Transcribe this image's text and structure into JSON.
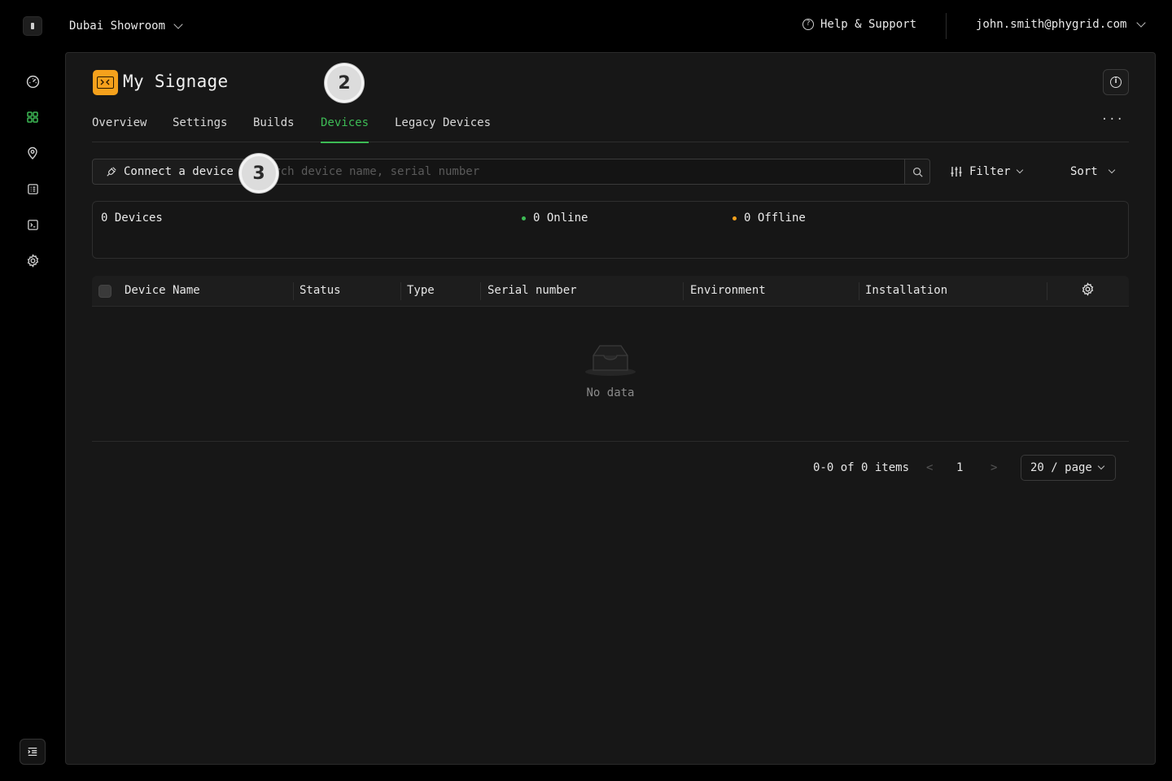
{
  "header": {
    "workspace": "Dubai Showroom",
    "help_label": "Help & Support",
    "user_email": "john.smith@phygrid.com"
  },
  "rail": {
    "items": [
      {
        "icon": "dashboard-gauge-icon",
        "active": false
      },
      {
        "icon": "grid-apps-icon",
        "active": true
      },
      {
        "icon": "location-pin-icon",
        "active": false
      },
      {
        "icon": "list-document-icon",
        "active": false
      },
      {
        "icon": "terminal-icon",
        "active": false
      },
      {
        "icon": "gear-icon",
        "active": false
      }
    ],
    "collapse_icon": "sidebar-collapse-icon"
  },
  "project": {
    "title": "My Signage",
    "icon_color": "#f5a11c"
  },
  "tabs": [
    {
      "label": "Overview",
      "active": false
    },
    {
      "label": "Settings",
      "active": false
    },
    {
      "label": "Builds",
      "active": false
    },
    {
      "label": "Devices",
      "active": true
    },
    {
      "label": "Legacy Devices",
      "active": false
    }
  ],
  "tabs_more": "···",
  "toolbar": {
    "connect_label": "Connect a device",
    "search_placeholder": "Search device name, serial number",
    "filter_label": "Filter",
    "sort_label": "Sort"
  },
  "stats": {
    "devices": "0 Devices",
    "online": "0 Online",
    "offline": "0 Offline",
    "online_color": "#3dbb55",
    "offline_color": "#f5a11c"
  },
  "table": {
    "columns": [
      "Device Name",
      "Status",
      "Type",
      "Serial number",
      "Environment",
      "Installation"
    ],
    "rows": [],
    "empty_text": "No data"
  },
  "pagination": {
    "range": "0-0 of 0 items",
    "prev": "<",
    "current_page": "1",
    "next": ">",
    "page_size": "20 / page"
  },
  "annotations": {
    "step_2": "2",
    "step_3": "3"
  },
  "accent_color": "#3dbb55"
}
